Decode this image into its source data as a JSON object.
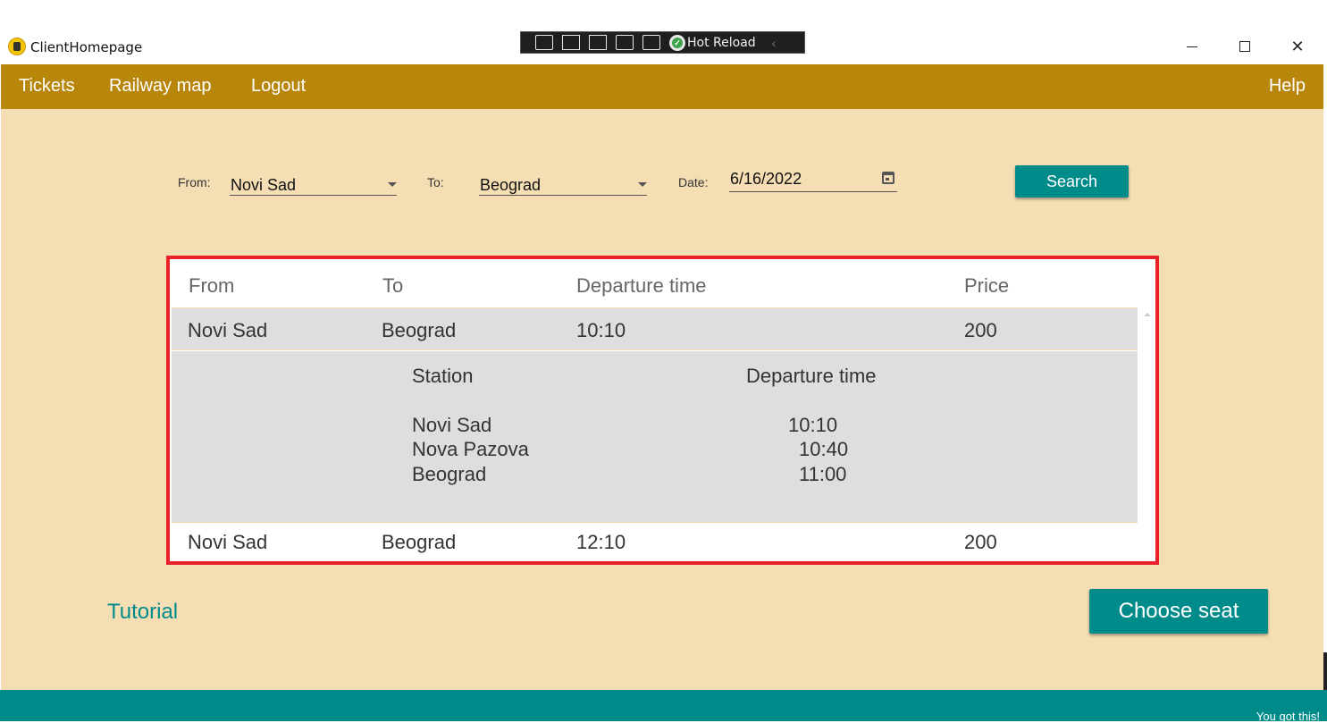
{
  "window": {
    "title": "ClientHomepage",
    "controls": {
      "minimize": "minimize",
      "maximize": "maximize",
      "close": "✕"
    }
  },
  "debug_toolbar": {
    "hot_reload_label": "Hot Reload"
  },
  "menu": {
    "tickets": "Tickets",
    "railway_map": "Railway map",
    "logout": "Logout",
    "help": "Help"
  },
  "search": {
    "from_label": "From:",
    "from_value": "Novi Sad",
    "to_label": "To:",
    "to_value": "Beograd",
    "date_label": "Date:",
    "date_value": "6/16/2022",
    "search_button": "Search"
  },
  "grid": {
    "headers": [
      "From",
      "To",
      "Departure time",
      "Price"
    ],
    "rows": [
      {
        "from": "Novi Sad",
        "to": "Beograd",
        "departure": "10:10",
        "price": "200"
      },
      {
        "from": "Novi Sad",
        "to": "Beograd",
        "departure": "12:10",
        "price": "200"
      }
    ],
    "details": {
      "headers": [
        "Station",
        "Departure time"
      ],
      "stops": [
        {
          "station": "Novi Sad",
          "time": "10:10"
        },
        {
          "station": "Nova Pazova",
          "time": "10:40"
        },
        {
          "station": "Beograd",
          "time": "11:00"
        }
      ]
    }
  },
  "tutorial_link": "Tutorial",
  "choose_seat_button": "Choose seat",
  "footer": {
    "note": "You got this!"
  },
  "colors": {
    "menu_bar": "#b8860b",
    "background": "#f5deb3",
    "accent": "#008b8b",
    "highlight_border": "#e8202a",
    "row_selected": "#dedede"
  },
  "icons": {
    "app": "train-icon",
    "calendar": "calendar-icon",
    "dropdown": "chevron-down-icon",
    "hot_reload": "check-circle-icon"
  }
}
